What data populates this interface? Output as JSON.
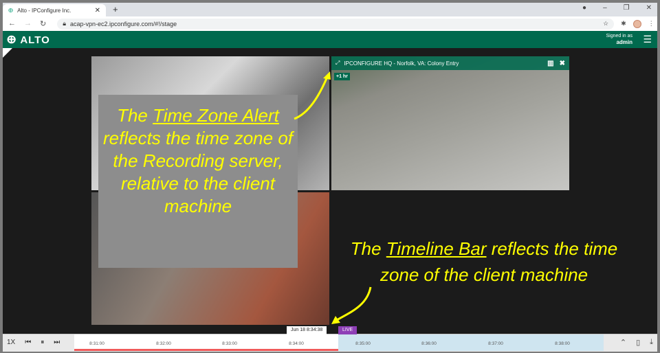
{
  "browser": {
    "tab_title": "Alto - IPConfigure Inc.",
    "url": "acap-vpn-ec2.ipconfigure.com/#!/stage"
  },
  "header": {
    "logo": "ALTO",
    "signed_in_label": "Signed in as",
    "user": "admin"
  },
  "camera": {
    "title": "IPCONFIGURE HQ - Norfolk, VA: Colony Entry",
    "tz_alert": "+1 hr"
  },
  "annotations": {
    "a1_pre": "The ",
    "a1_u": "Time Zone Alert",
    "a1_post": " reflects the time zone of the Recording server, relative to the client machine",
    "a2_pre": "The ",
    "a2_u": "Timeline Bar",
    "a2_post": " reflects the time zone of the client machine"
  },
  "timeline": {
    "speed": "1X",
    "current": "Jun 18 8:34:38",
    "live": "LIVE",
    "ticks": [
      "8:31:00",
      "8:32:00",
      "8:33:00",
      "8:34:00",
      "8:35:00",
      "8:36:00",
      "8:37:00",
      "8:38:00"
    ]
  }
}
